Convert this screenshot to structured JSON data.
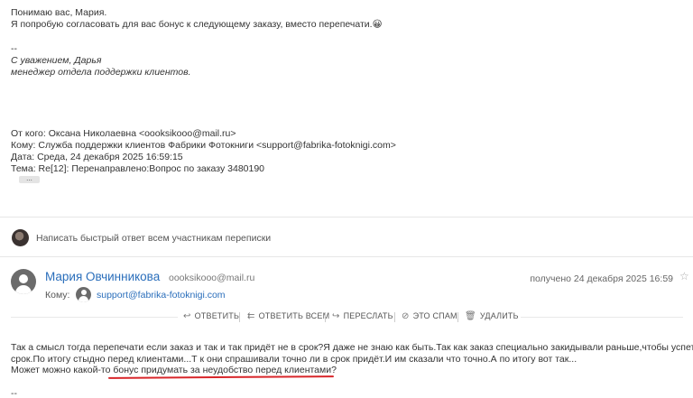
{
  "quoted_reply": {
    "greeting": "Понимаю вас, Мария.",
    "line2": "Я попробую согласовать для вас бонус к следующему заказу, вместо перепечати.",
    "emoji": "😀",
    "separator": "--",
    "regards": "С уважением, Дарья",
    "position": "менеджер отдела поддержки клиентов."
  },
  "quoted_header": {
    "from": "От кого: Оксана Николаевна <oooksikooo@mail.ru>",
    "to": "Кому: Служба поддержки клиентов Фабрики Фотокниги <support@fabrika-fotoknigi.com>",
    "date": "Дата: Среда, 24 декабря 2025 16:59:15",
    "subject": "Тема: Re[12]: Перенаправлено:Вопрос по заказу 3480190",
    "more_button": "..."
  },
  "quick_reply": {
    "placeholder": "Написать быстрый ответ всем участникам переписки"
  },
  "message": {
    "sender_name": "Мария Овчинникова",
    "sender_email": "oooksikooo@mail.ru",
    "received": "получено 24 декабря 2025 16:59",
    "to_label": "Кому:",
    "to_email": "support@fabrika-fotoknigi.com",
    "body_line1": "Так а смысл тогда перепечати если заказ и так и так придёт не в срок?Я даже не знаю как быть.Так как заказ специально закидывали раньше,чтобы успеть в",
    "body_line2": "срок.По итогу стыдно перед клиентами...Т к они спрашивали точно ли в срок придёт.И им сказали что точно.А по итогу вот так...",
    "body_line3": "Может можно какой-то бонус придумать за неудобство перед клиентами?",
    "trailing": "--"
  },
  "actions": {
    "reply": "ОТВЕТИТЬ",
    "reply_all": "ОТВЕТИТЬ ВСЕМ",
    "forward": "ПЕРЕСЛАТЬ",
    "spam": "ЭТО СПАМ",
    "delete": "УДАЛИТЬ"
  },
  "colors": {
    "link": "#2a6ebb",
    "highlight_underline": "#d8262a"
  }
}
